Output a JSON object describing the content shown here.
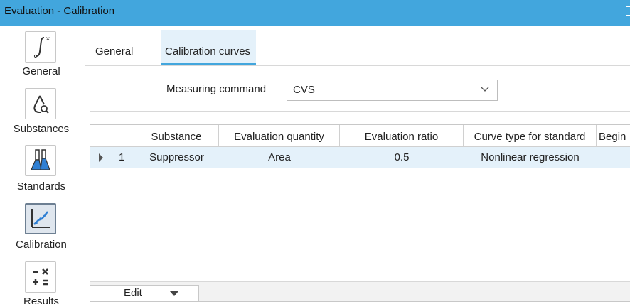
{
  "window": {
    "title": "Evaluation - Calibration"
  },
  "sidebar": {
    "items": [
      {
        "label": "General",
        "icon": "integral-icon",
        "active": false
      },
      {
        "label": "Substances",
        "icon": "drop-search-icon",
        "active": false
      },
      {
        "label": "Standards",
        "icon": "flasks-icon",
        "active": false
      },
      {
        "label": "Calibration",
        "icon": "calibration-curve-icon",
        "active": true
      },
      {
        "label": "Results",
        "icon": "calculator-icon",
        "active": false
      }
    ]
  },
  "tabs": [
    {
      "label": "General",
      "active": false
    },
    {
      "label": "Calibration curves",
      "active": true
    }
  ],
  "measuring_command": {
    "label": "Measuring command",
    "value": "CVS"
  },
  "table": {
    "columns": [
      "Substance",
      "Evaluation quantity",
      "Evaluation ratio",
      "Curve type for standard",
      "Begin"
    ],
    "rows": [
      {
        "index": "1",
        "substance": "Suppressor",
        "evaluation_quantity": "Area",
        "evaluation_ratio": "0.5",
        "curve_type": "Nonlinear regression",
        "begin": ""
      }
    ]
  },
  "footer": {
    "edit_label": "Edit"
  },
  "colors": {
    "accent": "#42a6dd",
    "selection": "#e4f1fa",
    "icon_blue": "#2f7fd3"
  }
}
